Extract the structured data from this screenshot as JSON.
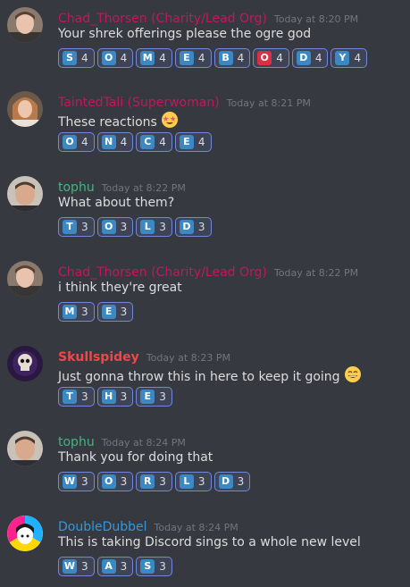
{
  "colors": {
    "background": "#36393f",
    "timestamp": "#72767d",
    "text": "#dcddde",
    "reaction_border": "#7289da",
    "letter_blue": "#3b88c3",
    "letter_red": "#dd2e44"
  },
  "messages": [
    {
      "author": "Chad_Thorsen (Charity/Lead Org)",
      "author_color": "#c2185b",
      "timestamp": "Today at 8:20 PM",
      "text": "Your shrek offerings please the ogre god",
      "avatar": "avatar-chad",
      "reactions": [
        {
          "letter": "S",
          "count": "4"
        },
        {
          "letter": "O",
          "count": "4"
        },
        {
          "letter": "M",
          "count": "4"
        },
        {
          "letter": "E",
          "count": "4"
        },
        {
          "letter": "B",
          "count": "4"
        },
        {
          "letter": "O",
          "count": "4",
          "style": "red"
        },
        {
          "letter": "D",
          "count": "4"
        },
        {
          "letter": "Y",
          "count": "4"
        }
      ]
    },
    {
      "author": "TaintedTali (Superwoman)",
      "author_color": "#c2185b",
      "timestamp": "Today at 8:21 PM",
      "text": "These reactions",
      "inline_emoji": "star-struck-emoji",
      "avatar": "avatar-tali",
      "reactions": [
        {
          "letter": "O",
          "count": "4"
        },
        {
          "letter": "N",
          "count": "4"
        },
        {
          "letter": "C",
          "count": "4"
        },
        {
          "letter": "E",
          "count": "4"
        }
      ]
    },
    {
      "author": "tophu",
      "author_color": "#43b581",
      "timestamp": "Today at 8:22 PM",
      "text": "What about them?",
      "avatar": "avatar-tophu",
      "reactions": [
        {
          "letter": "T",
          "count": "3"
        },
        {
          "letter": "O",
          "count": "3"
        },
        {
          "letter": "L",
          "count": "3"
        },
        {
          "letter": "D",
          "count": "3"
        }
      ]
    },
    {
      "author": "Chad_Thorsen (Charity/Lead Org)",
      "author_color": "#c2185b",
      "timestamp": "Today at 8:22 PM",
      "text": "i think they're great",
      "avatar": "avatar-chad",
      "reactions": [
        {
          "letter": "M",
          "count": "3"
        },
        {
          "letter": "E",
          "count": "3"
        }
      ]
    },
    {
      "author": "Skullspidey",
      "author_color": "#f04747",
      "timestamp": "Today at 8:23 PM",
      "text": "Just gonna throw this in here to keep it going",
      "inline_emoji": "grinning-emoji",
      "avatar": "avatar-skull",
      "reactions": [
        {
          "letter": "T",
          "count": "3"
        },
        {
          "letter": "H",
          "count": "3"
        },
        {
          "letter": "E",
          "count": "3"
        }
      ]
    },
    {
      "author": "tophu",
      "author_color": "#43b581",
      "timestamp": "Today at 8:24 PM",
      "text": "Thank you for doing that",
      "avatar": "avatar-tophu",
      "reactions": [
        {
          "letter": "W",
          "count": "3"
        },
        {
          "letter": "O",
          "count": "3"
        },
        {
          "letter": "R",
          "count": "3"
        },
        {
          "letter": "L",
          "count": "3"
        },
        {
          "letter": "D",
          "count": "3"
        }
      ]
    },
    {
      "author": "DoubleDubbel",
      "author_color": "#3498db",
      "timestamp": "Today at 8:24 PM",
      "text": "This is taking Discord sings to a whole new level",
      "avatar": "avatar-doubledubbel",
      "reactions": [
        {
          "letter": "W",
          "count": "3"
        },
        {
          "letter": "A",
          "count": "3"
        },
        {
          "letter": "S",
          "count": "3"
        }
      ]
    }
  ]
}
